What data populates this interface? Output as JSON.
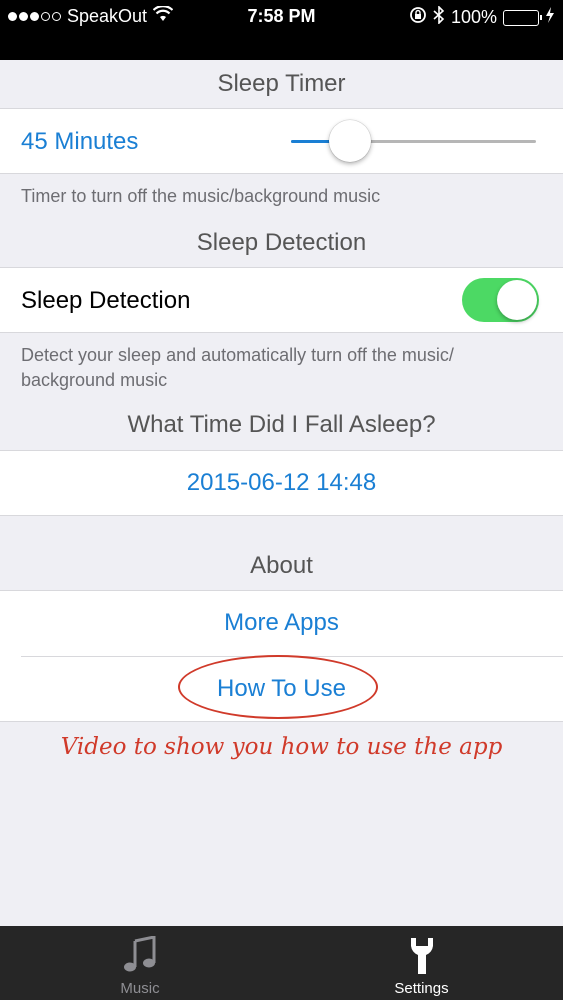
{
  "status_bar": {
    "carrier": "SpeakOut",
    "time": "7:58 PM",
    "battery": "100%"
  },
  "sleep_timer": {
    "header": "Sleep Timer",
    "value_label": "45 Minutes",
    "slider_fraction": 0.24,
    "footnote": "Timer to turn off the music/background music"
  },
  "sleep_detection": {
    "header": "Sleep Detection",
    "row_label": "Sleep Detection",
    "enabled": true,
    "footnote": "Detect your sleep and automatically turn off the music/ background music"
  },
  "fall_asleep": {
    "header": "What Time Did I Fall Asleep?",
    "value": "2015-06-12 14:48"
  },
  "about": {
    "header": "About",
    "more_apps": "More Apps",
    "how_to_use": "How To Use"
  },
  "annotation": "Video to show you how to use the app",
  "tabs": [
    {
      "label": "Music",
      "icon": "music-note-icon",
      "active": false
    },
    {
      "label": "Settings",
      "icon": "wrench-icon",
      "active": true
    }
  ],
  "colors": {
    "accent": "#1a7fd4",
    "toggle_on": "#4cd964",
    "annotation": "#d03a2a",
    "tab_bar": "#262626"
  }
}
